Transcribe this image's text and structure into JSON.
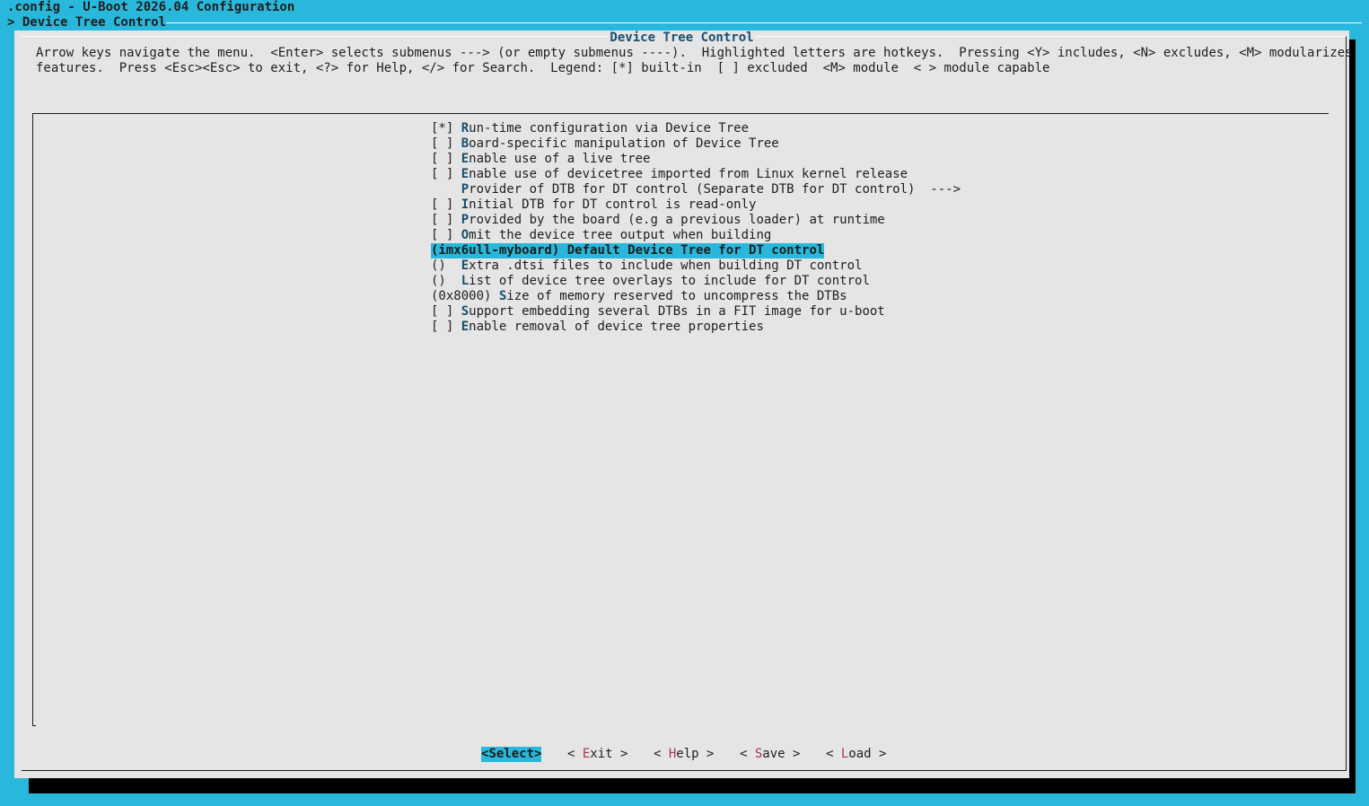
{
  "window": {
    "title": ".config - U-Boot 2026.04 Configuration",
    "breadcrumb": "> Device Tree Control"
  },
  "dialog": {
    "title": "Device Tree Control",
    "help_line_1": "Arrow keys navigate the menu.  <Enter> selects submenus ---> (or empty submenus ----).  Highlighted letters are hotkeys.  Pressing <Y> includes, <N> excludes, <M> modularizes",
    "help_line_2": "features.  Press <Esc><Esc> to exit, <?> for Help, </> for Search.  Legend: [*] built-in  [ ] excluded  <M> module  < > module capable"
  },
  "menu": {
    "items": [
      {
        "prefix": "[*] ",
        "hotkey": "R",
        "rest": "un-time configuration via Device Tree",
        "selected": false
      },
      {
        "prefix": "[ ] ",
        "hotkey": "B",
        "rest": "oard-specific manipulation of Device Tree",
        "selected": false
      },
      {
        "prefix": "[ ] ",
        "hotkey": "E",
        "rest": "nable use of a live tree",
        "selected": false
      },
      {
        "prefix": "[ ] ",
        "hotkey": "E",
        "rest": "nable use of devicetree imported from Linux kernel release",
        "selected": false
      },
      {
        "prefix": "    ",
        "hotkey": "P",
        "rest": "rovider of DTB for DT control (Separate DTB for DT control)  --->",
        "selected": false
      },
      {
        "prefix": "[ ] ",
        "hotkey": "I",
        "rest": "nitial DTB for DT control is read-only",
        "selected": false
      },
      {
        "prefix": "[ ] ",
        "hotkey": "P",
        "rest": "rovided by the board (e.g a previous loader) at runtime",
        "selected": false
      },
      {
        "prefix": "[ ] ",
        "hotkey": "O",
        "rest": "mit the device tree output when building",
        "selected": false
      },
      {
        "prefix": "(imx6ull-myboard) ",
        "hotkey": "D",
        "rest": "efault Device Tree for DT control",
        "selected": true
      },
      {
        "prefix": "()  ",
        "hotkey": "E",
        "rest": "xtra .dtsi files to include when building DT control",
        "selected": false
      },
      {
        "prefix": "()  ",
        "hotkey": "L",
        "rest": "ist of device tree overlays to include for DT control",
        "selected": false
      },
      {
        "prefix": "(0x8000) ",
        "hotkey": "S",
        "rest": "ize of memory reserved to uncompress the DTBs",
        "selected": false
      },
      {
        "prefix": "[ ] ",
        "hotkey": "S",
        "rest": "upport embedding several DTBs in a FIT image for u-boot",
        "selected": false
      },
      {
        "prefix": "[ ] ",
        "hotkey": "E",
        "rest": "nable removal of device tree properties",
        "selected": false
      }
    ]
  },
  "buttons": {
    "select": {
      "pre": "<",
      "hot": "S",
      "post": "elect>"
    },
    "exit": {
      "pre": "< ",
      "hot": "E",
      "post": "xit >"
    },
    "help": {
      "pre": "< ",
      "hot": "H",
      "post": "elp >"
    },
    "save": {
      "pre": "< ",
      "hot": "S",
      "post": "ave >"
    },
    "load": {
      "pre": "< ",
      "hot": "L",
      "post": "oad >"
    }
  },
  "colors": {
    "background": "#29b8db",
    "dialog": "#e5e5e5",
    "highlight": "#29b8db",
    "hotkey_menu": "#1a4f6e",
    "hotkey_button": "#b0344c"
  }
}
